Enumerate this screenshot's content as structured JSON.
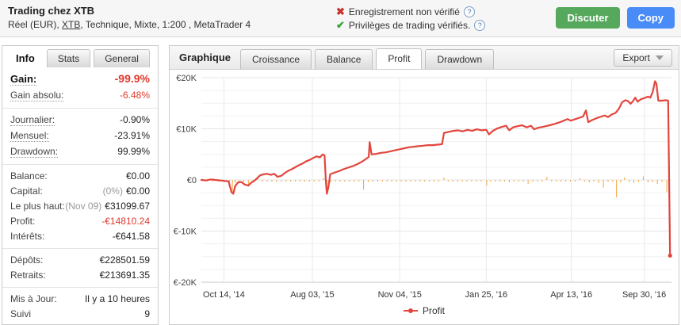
{
  "icons": {
    "cross": "✖",
    "check": "✔",
    "help": "?",
    "caret": "caret-down"
  },
  "header": {
    "title": "Trading chez XTB",
    "subtitle": {
      "pre": "Réel (EUR), ",
      "link": "XTB",
      "post": ", Technique, Mixte, 1:200 , MetaTrader 4"
    },
    "verification": [
      {
        "icon": "cross",
        "text": "Enregistrement non vérifié"
      },
      {
        "icon": "check",
        "text": "Privilèges de trading vérifiés."
      }
    ],
    "buttons": [
      {
        "id": "discuter",
        "label": "Discuter",
        "color": "#55a85c"
      },
      {
        "id": "copy",
        "label": "Copy",
        "color": "#4a8cf7"
      }
    ]
  },
  "sidebar": {
    "tabs": [
      {
        "label": "Info",
        "active": true
      },
      {
        "label": "Stats",
        "active": false
      },
      {
        "label": "General",
        "active": false
      }
    ],
    "groups": [
      {
        "rows": [
          {
            "label": "Gain:",
            "value": "-99.9%",
            "red": true,
            "big": true,
            "dotted": true
          },
          {
            "label": "Gain absolu:",
            "value": "-6.48%",
            "red": true,
            "dotted": true
          }
        ]
      },
      {
        "rows": [
          {
            "label": "Journalier:",
            "value": "-0.90%",
            "dotted": true
          },
          {
            "label": "Mensuel:",
            "value": "-23.91%",
            "dotted": true
          },
          {
            "label": "Drawdown:",
            "value": "99.99%",
            "dotted": true
          }
        ]
      },
      {
        "rows": [
          {
            "label": "Balance:",
            "value": "€0.00"
          },
          {
            "label": "Capital:",
            "prefix": "(0%)",
            "value": "€0.00"
          },
          {
            "label": "Le plus haut:",
            "prefix": "(Nov 09)",
            "value": "€31099.67"
          },
          {
            "label": "Profit:",
            "value": "-€14810.24",
            "red": true
          },
          {
            "label": "Intérêts:",
            "value": "-€641.58"
          }
        ]
      },
      {
        "rows": [
          {
            "label": "Dépôts:",
            "value": "€228501.59"
          },
          {
            "label": "Retraits:",
            "value": "€213691.35"
          }
        ]
      },
      {
        "rows": [
          {
            "label": "Mis à Jour:",
            "value": "Il y a 10 heures"
          },
          {
            "label": "Suivi",
            "value": "9"
          }
        ]
      }
    ]
  },
  "chart_panel": {
    "title": "Graphique",
    "tabs": [
      {
        "label": "Croissance",
        "active": false
      },
      {
        "label": "Balance",
        "active": false
      },
      {
        "label": "Profit",
        "active": true
      },
      {
        "label": "Drawdown",
        "active": false
      }
    ],
    "export_label": "Export"
  },
  "chart_data": {
    "type": "line",
    "title": "Profit",
    "units": "thousands of EUR",
    "ylim": [
      -20,
      20
    ],
    "y_minor_step": 2.5,
    "yticks": [
      {
        "v": 20,
        "label": "€20K"
      },
      {
        "v": 10,
        "label": "€10K"
      },
      {
        "v": 0,
        "label": "€0"
      },
      {
        "v": -10,
        "label": "€-10K"
      },
      {
        "v": -20,
        "label": "€-20K"
      }
    ],
    "xticks": [
      {
        "frac": 0.048,
        "label": "Oct 14, '14"
      },
      {
        "frac": 0.236,
        "label": "Aug 03, '15"
      },
      {
        "frac": 0.422,
        "label": "Nov 04, '15"
      },
      {
        "frac": 0.606,
        "label": "Jan 25, '16"
      },
      {
        "frac": 0.787,
        "label": "Apr 13, '16"
      },
      {
        "frac": 0.942,
        "label": "Sep 30, '16"
      }
    ],
    "grid": true,
    "legend_position": "bottom-center",
    "series": [
      {
        "name": "Profit",
        "color": "#e2463d",
        "points": [
          [
            0.0,
            0.0
          ],
          [
            0.01,
            -0.1
          ],
          [
            0.02,
            0.1
          ],
          [
            0.03,
            0.0
          ],
          [
            0.04,
            -0.1
          ],
          [
            0.05,
            -0.2
          ],
          [
            0.058,
            -0.3
          ],
          [
            0.064,
            -2.4
          ],
          [
            0.068,
            -2.7
          ],
          [
            0.072,
            -1.2
          ],
          [
            0.078,
            -0.5
          ],
          [
            0.085,
            -0.4
          ],
          [
            0.092,
            -0.9
          ],
          [
            0.1,
            -1.1
          ],
          [
            0.105,
            -0.6
          ],
          [
            0.112,
            -0.2
          ],
          [
            0.118,
            0.3
          ],
          [
            0.125,
            0.9
          ],
          [
            0.132,
            1.1
          ],
          [
            0.14,
            1.2
          ],
          [
            0.148,
            1.0
          ],
          [
            0.155,
            1.2
          ],
          [
            0.162,
            0.6
          ],
          [
            0.17,
            0.8
          ],
          [
            0.178,
            1.4
          ],
          [
            0.185,
            1.8
          ],
          [
            0.192,
            2.1
          ],
          [
            0.2,
            2.5
          ],
          [
            0.208,
            2.9
          ],
          [
            0.215,
            3.2
          ],
          [
            0.222,
            3.6
          ],
          [
            0.23,
            3.9
          ],
          [
            0.238,
            4.3
          ],
          [
            0.245,
            4.6
          ],
          [
            0.252,
            4.4
          ],
          [
            0.258,
            5.0
          ],
          [
            0.262,
            4.8
          ],
          [
            0.265,
            -0.5
          ],
          [
            0.267,
            -2.7
          ],
          [
            0.27,
            -1.5
          ],
          [
            0.274,
            1.1
          ],
          [
            0.282,
            1.4
          ],
          [
            0.292,
            1.7
          ],
          [
            0.302,
            2.1
          ],
          [
            0.312,
            2.4
          ],
          [
            0.322,
            2.7
          ],
          [
            0.332,
            3.1
          ],
          [
            0.342,
            3.6
          ],
          [
            0.35,
            4.1
          ],
          [
            0.356,
            4.5
          ],
          [
            0.358,
            7.4
          ],
          [
            0.362,
            5.0
          ],
          [
            0.372,
            5.1
          ],
          [
            0.382,
            5.3
          ],
          [
            0.392,
            5.4
          ],
          [
            0.402,
            5.6
          ],
          [
            0.412,
            5.8
          ],
          [
            0.422,
            6.0
          ],
          [
            0.432,
            6.2
          ],
          [
            0.442,
            6.4
          ],
          [
            0.452,
            6.5
          ],
          [
            0.462,
            6.6
          ],
          [
            0.472,
            6.7
          ],
          [
            0.482,
            6.8
          ],
          [
            0.492,
            6.8
          ],
          [
            0.502,
            6.9
          ],
          [
            0.512,
            7.0
          ],
          [
            0.516,
            9.2
          ],
          [
            0.526,
            9.4
          ],
          [
            0.536,
            9.6
          ],
          [
            0.546,
            9.7
          ],
          [
            0.556,
            9.5
          ],
          [
            0.566,
            9.8
          ],
          [
            0.576,
            9.6
          ],
          [
            0.586,
            9.9
          ],
          [
            0.596,
            9.7
          ],
          [
            0.606,
            9.8
          ],
          [
            0.612,
            8.9
          ],
          [
            0.62,
            9.6
          ],
          [
            0.63,
            10.1
          ],
          [
            0.64,
            10.4
          ],
          [
            0.648,
            10.6
          ],
          [
            0.655,
            9.7
          ],
          [
            0.663,
            10.3
          ],
          [
            0.672,
            10.5
          ],
          [
            0.682,
            10.7
          ],
          [
            0.692,
            10.3
          ],
          [
            0.701,
            10.6
          ],
          [
            0.708,
            9.9
          ],
          [
            0.716,
            10.2
          ],
          [
            0.727,
            10.4
          ],
          [
            0.741,
            10.7
          ],
          [
            0.753,
            11.0
          ],
          [
            0.763,
            11.3
          ],
          [
            0.771,
            11.6
          ],
          [
            0.779,
            11.9
          ],
          [
            0.786,
            11.6
          ],
          [
            0.792,
            11.8
          ],
          [
            0.802,
            12.1
          ],
          [
            0.812,
            12.4
          ],
          [
            0.818,
            13.6
          ],
          [
            0.823,
            11.3
          ],
          [
            0.831,
            11.7
          ],
          [
            0.841,
            12.1
          ],
          [
            0.851,
            12.4
          ],
          [
            0.858,
            12.6
          ],
          [
            0.865,
            12.3
          ],
          [
            0.873,
            12.8
          ],
          [
            0.881,
            13.1
          ],
          [
            0.888,
            13.9
          ],
          [
            0.895,
            15.2
          ],
          [
            0.902,
            15.6
          ],
          [
            0.908,
            15.4
          ],
          [
            0.913,
            14.9
          ],
          [
            0.918,
            15.4
          ],
          [
            0.923,
            16.1
          ],
          [
            0.928,
            15.3
          ],
          [
            0.935,
            15.8
          ],
          [
            0.942,
            16.0
          ],
          [
            0.95,
            16.3
          ],
          [
            0.955,
            16.1
          ],
          [
            0.96,
            17.2
          ],
          [
            0.965,
            19.3
          ],
          [
            0.968,
            18.8
          ],
          [
            0.972,
            15.5
          ],
          [
            0.98,
            15.5
          ],
          [
            0.988,
            15.6
          ],
          [
            0.993,
            15.5
          ],
          [
            0.997,
            -14.8
          ]
        ]
      }
    ],
    "daily_bars": {
      "name": "daily change",
      "color": "#f3a33a",
      "points": [
        [
          0.012,
          -0.1
        ],
        [
          0.024,
          -0.15
        ],
        [
          0.036,
          -0.1
        ],
        [
          0.048,
          -0.2
        ],
        [
          0.06,
          -0.25
        ],
        [
          0.066,
          -2.3
        ],
        [
          0.072,
          -0.6
        ],
        [
          0.08,
          -0.3
        ],
        [
          0.09,
          -0.5
        ],
        [
          0.1,
          -0.9
        ],
        [
          0.11,
          -0.3
        ],
        [
          0.12,
          0.3
        ],
        [
          0.13,
          -0.2
        ],
        [
          0.14,
          -0.15
        ],
        [
          0.15,
          -0.2
        ],
        [
          0.16,
          -0.4
        ],
        [
          0.17,
          -0.2
        ],
        [
          0.18,
          -0.15
        ],
        [
          0.19,
          -0.2
        ],
        [
          0.2,
          -0.25
        ],
        [
          0.21,
          -0.2
        ],
        [
          0.22,
          -0.3
        ],
        [
          0.23,
          -0.2
        ],
        [
          0.24,
          -0.3
        ],
        [
          0.25,
          -0.2
        ],
        [
          0.26,
          0.4
        ],
        [
          0.267,
          -2.2
        ],
        [
          0.275,
          -0.5
        ],
        [
          0.285,
          -0.2
        ],
        [
          0.295,
          -0.25
        ],
        [
          0.305,
          -0.2
        ],
        [
          0.315,
          -0.3
        ],
        [
          0.325,
          -0.2
        ],
        [
          0.335,
          -0.25
        ],
        [
          0.345,
          -1.9
        ],
        [
          0.355,
          -0.4
        ],
        [
          0.365,
          -0.2
        ],
        [
          0.375,
          -0.3
        ],
        [
          0.385,
          -0.2
        ],
        [
          0.395,
          -0.25
        ],
        [
          0.405,
          -0.2
        ],
        [
          0.415,
          -0.3
        ],
        [
          0.425,
          -0.2
        ],
        [
          0.435,
          -0.25
        ],
        [
          0.445,
          -0.2
        ],
        [
          0.455,
          -0.3
        ],
        [
          0.465,
          -0.2
        ],
        [
          0.475,
          -0.25
        ],
        [
          0.485,
          -0.2
        ],
        [
          0.495,
          -0.3
        ],
        [
          0.505,
          -0.2
        ],
        [
          0.516,
          0.5
        ],
        [
          0.525,
          -0.25
        ],
        [
          0.535,
          -0.2
        ],
        [
          0.545,
          -0.3
        ],
        [
          0.555,
          -0.2
        ],
        [
          0.565,
          -0.25
        ],
        [
          0.575,
          -0.2
        ],
        [
          0.585,
          -0.3
        ],
        [
          0.595,
          -0.2
        ],
        [
          0.607,
          -1.1
        ],
        [
          0.615,
          -0.3
        ],
        [
          0.625,
          -0.2
        ],
        [
          0.635,
          -0.25
        ],
        [
          0.645,
          -0.2
        ],
        [
          0.655,
          -0.5
        ],
        [
          0.665,
          -0.2
        ],
        [
          0.675,
          -0.25
        ],
        [
          0.685,
          -0.2
        ],
        [
          0.695,
          -0.8
        ],
        [
          0.705,
          -0.3
        ],
        [
          0.715,
          -0.2
        ],
        [
          0.725,
          -0.25
        ],
        [
          0.735,
          0.6
        ],
        [
          0.745,
          -0.3
        ],
        [
          0.755,
          -0.2
        ],
        [
          0.765,
          -0.25
        ],
        [
          0.775,
          -0.2
        ],
        [
          0.785,
          -0.3
        ],
        [
          0.795,
          -0.2
        ],
        [
          0.805,
          0.4
        ],
        [
          0.815,
          -0.3
        ],
        [
          0.825,
          -0.5
        ],
        [
          0.835,
          -0.3
        ],
        [
          0.845,
          -0.6
        ],
        [
          0.855,
          -1.5
        ],
        [
          0.865,
          -0.4
        ],
        [
          0.875,
          -0.3
        ],
        [
          0.883,
          -3.4
        ],
        [
          0.892,
          -0.5
        ],
        [
          0.9,
          0.5
        ],
        [
          0.91,
          -0.4
        ],
        [
          0.92,
          -0.6
        ],
        [
          0.93,
          -0.4
        ],
        [
          0.94,
          0.7
        ],
        [
          0.95,
          -0.5
        ],
        [
          0.96,
          -0.4
        ],
        [
          0.97,
          -0.8
        ],
        [
          0.98,
          -0.4
        ],
        [
          0.99,
          -2.4
        ]
      ]
    },
    "legend": [
      {
        "label": "Profit",
        "color": "#e2463d"
      }
    ]
  }
}
